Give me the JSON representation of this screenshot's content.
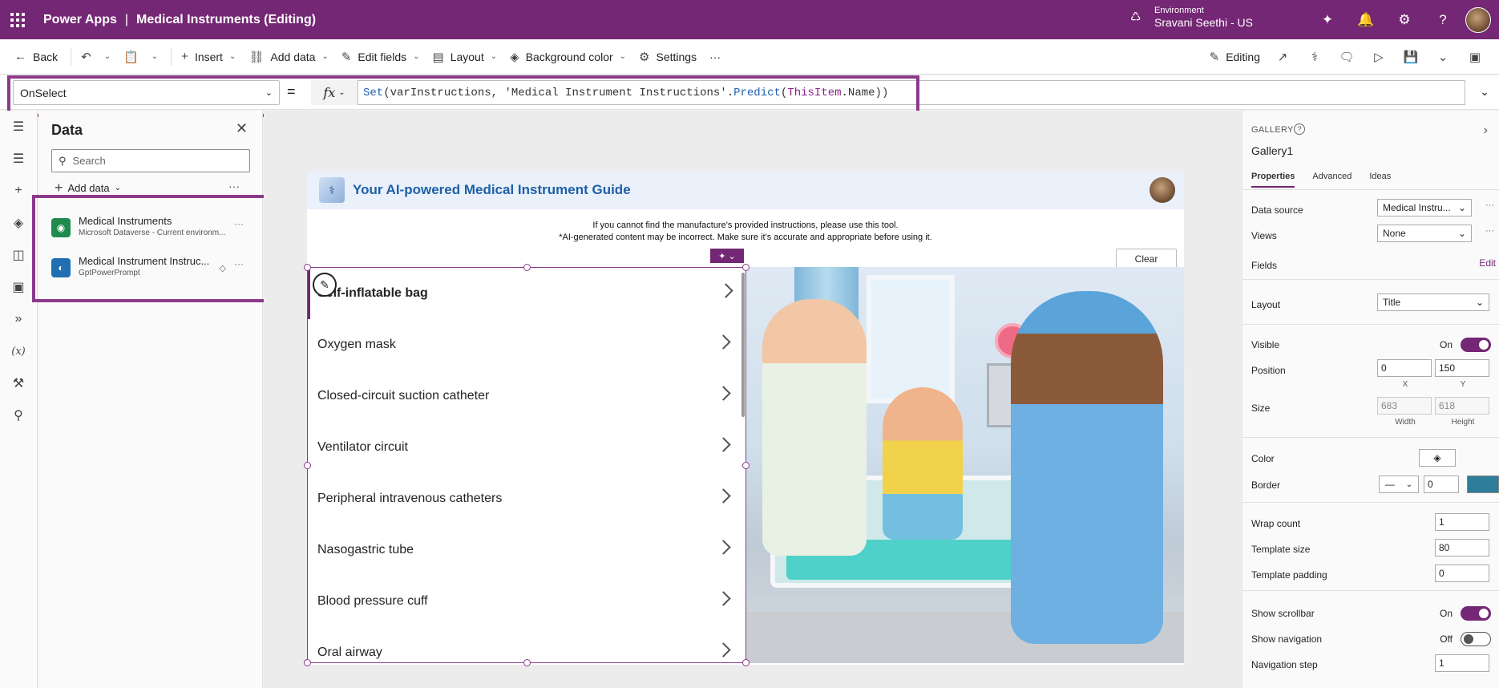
{
  "topbar": {
    "brand": "Power Apps",
    "separator": "|",
    "app_title": "Medical Instruments (Editing)",
    "environment_label": "Environment",
    "environment_name": "Sravani Seethi - US"
  },
  "commandbar": {
    "back": "Back",
    "insert": "Insert",
    "add_data": "Add data",
    "edit_fields": "Edit fields",
    "layout": "Layout",
    "background_color": "Background color",
    "settings": "Settings",
    "more": "···",
    "editing": "Editing"
  },
  "formula": {
    "property": "OnSelect",
    "equals": "=",
    "fx": "fx",
    "fn_set": "Set",
    "part1": "(varInstructions, 'Medical Instrument Instructions'.",
    "fn_predict": "Predict",
    "part2": "(",
    "kw_thisitem": "ThisItem",
    "part3": ".Name))"
  },
  "data_panel": {
    "title": "Data",
    "search_placeholder": "Search",
    "add_data": "Add data",
    "more": "···",
    "sources": [
      {
        "name": "Medical Instruments",
        "subtitle": "Microsoft Dataverse - Current environm...",
        "icon": "dataverse-icon",
        "color": "#1e8a4e"
      },
      {
        "name": "Medical Instrument Instruc...",
        "subtitle": "GptPowerPrompt",
        "icon": "ai-prompt-icon",
        "color": "#1f6fb2"
      }
    ]
  },
  "screen": {
    "header_title": "Your AI-powered Medical Instrument Guide",
    "note_line1": "If you cannot find the manufacture's provided instructions, please use this tool.",
    "note_line2": "*AI-generated content may be incorrect. Make sure it's accurate and appropriate before using it.",
    "clear_button": "Clear",
    "gallery_items": [
      "Self-inflatable bag",
      "Oxygen mask",
      "Closed-circuit suction catheter",
      "Ventilator circuit",
      "Peripheral intravenous catheters",
      "Nasogastric tube",
      "Blood pressure cuff",
      "Oral airway"
    ]
  },
  "properties": {
    "kind": "GALLERY",
    "name": "Gallery1",
    "tabs": [
      "Properties",
      "Advanced",
      "Ideas"
    ],
    "data_source_label": "Data source",
    "data_source_value": "Medical Instru...",
    "views_label": "Views",
    "views_value": "None",
    "fields_label": "Fields",
    "fields_edit": "Edit",
    "layout_label": "Layout",
    "layout_value": "Title",
    "visible_label": "Visible",
    "visible_state": "On",
    "position_label": "Position",
    "position_x": "0",
    "position_y": "150",
    "x_label": "X",
    "y_label": "Y",
    "size_label": "Size",
    "size_width": "683",
    "size_height": "618",
    "width_label": "Width",
    "height_label": "Height",
    "color_label": "Color",
    "border_label": "Border",
    "border_width": "0",
    "wrap_count_label": "Wrap count",
    "wrap_count": "1",
    "template_size_label": "Template size",
    "template_size": "80",
    "template_padding_label": "Template padding",
    "template_padding": "0",
    "show_scrollbar_label": "Show scrollbar",
    "show_scrollbar_state": "On",
    "show_navigation_label": "Show navigation",
    "show_navigation_state": "Off",
    "navigation_step_label": "Navigation step",
    "navigation_step": "1"
  },
  "colors": {
    "brand": "#742774",
    "highlight": "#8b3a8b",
    "border_color": "#2e7d9a"
  }
}
